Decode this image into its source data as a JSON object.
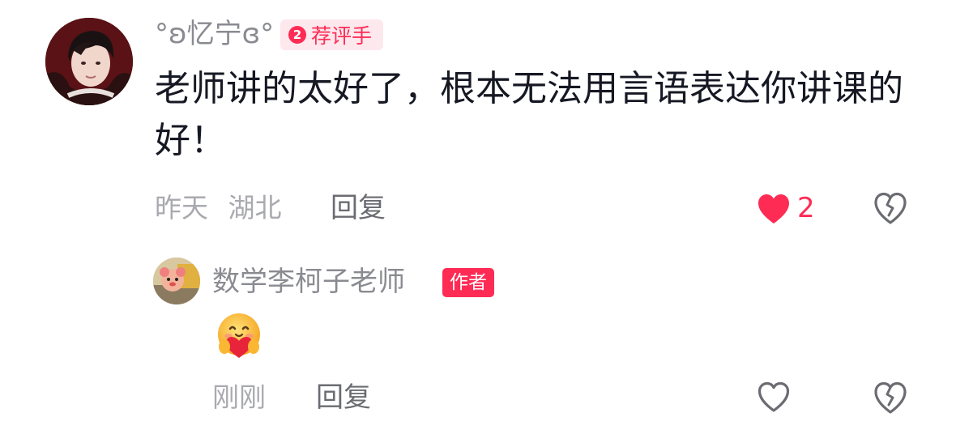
{
  "comment": {
    "username": "°ʚ忆宁ɞ°",
    "rank_badge": {
      "number": "2",
      "label": "荐评手"
    },
    "text": "老师讲的太好了，根本无法用言语表达你讲课的好！",
    "time": "昨天",
    "location": "湖北",
    "reply_label": "回复",
    "like_count": "2",
    "liked": true
  },
  "reply": {
    "username": "数学李柯子老师",
    "author_badge": "作者",
    "emoji": "smiling-face-with-heart-hug",
    "time": "刚刚",
    "reply_label": "回复",
    "liked": false
  },
  "colors": {
    "accent": "#fe2c55",
    "name_gray": "#8a8b91",
    "meta_gray": "#a9aab0",
    "text": "#161823"
  }
}
